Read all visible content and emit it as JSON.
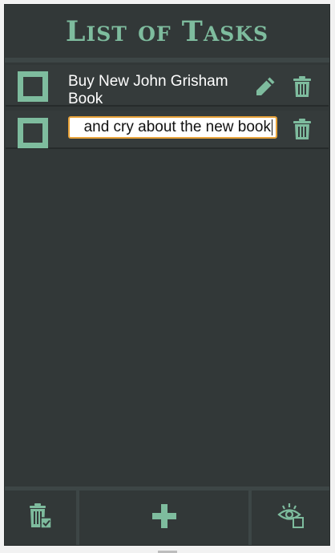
{
  "app": {
    "title": "List of Tasks",
    "accent_color": "#7ebc9e",
    "background_color": "#323838"
  },
  "tasks": [
    {
      "text": "Buy New John Grisham Book",
      "completed": false,
      "editing": false,
      "actions": [
        "pencil-icon",
        "trash-icon"
      ]
    },
    {
      "text": "and cry about the new book",
      "completed": false,
      "editing": true,
      "actions": [
        "trash-icon"
      ]
    }
  ],
  "footer": {
    "buttons": [
      {
        "icon": "trash-check-icon"
      },
      {
        "icon": "plus-icon"
      },
      {
        "icon": "eye-toggle-icon"
      }
    ]
  }
}
